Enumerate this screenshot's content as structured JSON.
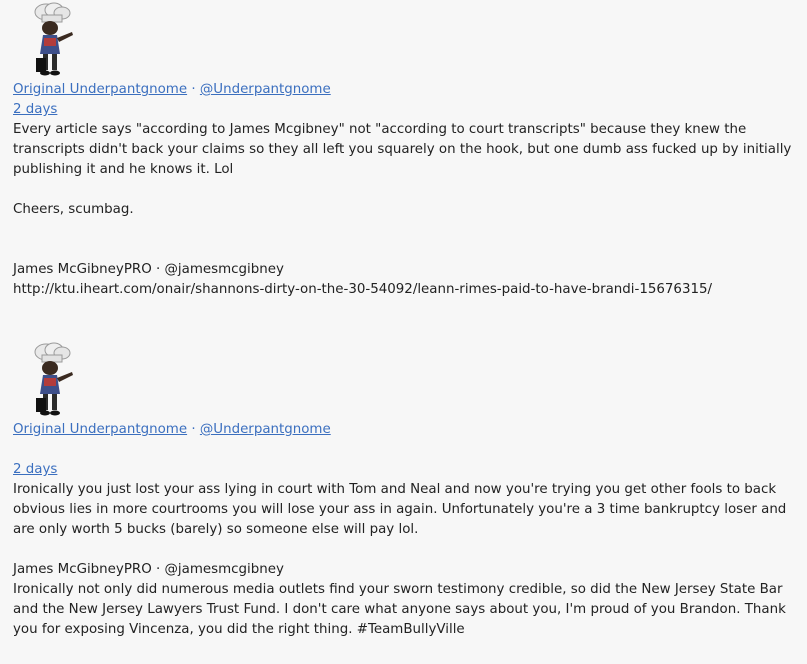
{
  "posts": [
    {
      "author_name": "Original Underpantgnome",
      "separator": "·",
      "handle": "@Underpantgnome",
      "timestamp": "2 days",
      "body": "Every article says \"according to James Mcgibney\" not \"according to court transcripts\" because they knew the transcripts didn't back your claims so they all left you squarely on the hook, but one dumb ass fucked up by initially publishing it and he knows it. Lol",
      "signoff": "Cheers, scumbag.",
      "quote": {
        "author": "James McGibneyPRO · @jamesmcgibney",
        "text": "http://ktu.iheart.com/onair/shannons-dirty-on-the-30-54092/leann-rimes-paid-to-have-brandi-15676315/"
      }
    },
    {
      "author_name": "Original Underpantgnome",
      "separator": "·",
      "handle": "@Underpantgnome",
      "timestamp": "2 days",
      "body": "Ironically you just lost your ass lying in court with Tom and Neal and now you're trying you get other fools to back obvious lies in more courtrooms you will lose your ass in again. Unfortunately you're a 3 time bankruptcy loser and are only worth 5 bucks (barely) so someone else will pay lol.",
      "quote": {
        "author": "James McGibneyPRO · @jamesmcgibney",
        "text": "Ironically not only did numerous media outlets find your sworn testimony credible, so did the New Jersey State Bar and the New Jersey Lawyers Trust Fund. I don't care what anyone says about you, I'm proud of you Brandon. Thank you for exposing Vincenza, you did the right thing. #TeamBullyVille"
      }
    }
  ],
  "icons": {
    "avatar": "gnome-chef-avatar-icon"
  },
  "colors": {
    "link": "#3b6fbf",
    "text": "#222222",
    "background": "#f7f7f7"
  }
}
